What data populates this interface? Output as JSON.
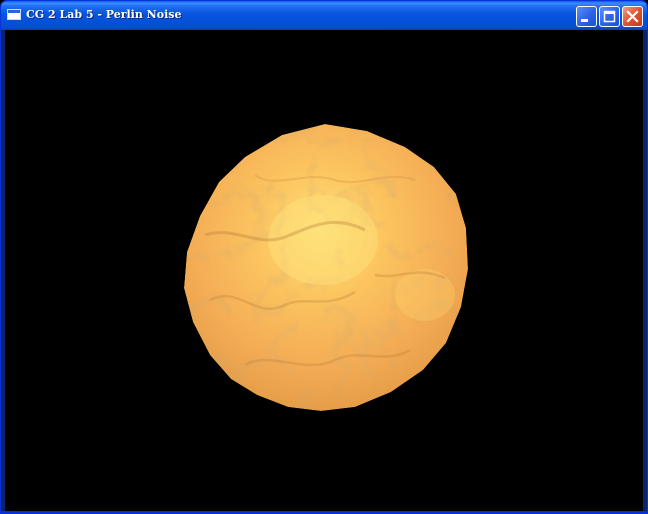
{
  "window": {
    "title": "CG 2 Lab 5 - Perlin Noise",
    "app_icon": "window-icon"
  },
  "titlebar_buttons": {
    "minimize": "minimize-icon",
    "maximize": "maximize-icon",
    "close": "close-icon"
  },
  "scene": {
    "background": "#000000",
    "sphere_colors": {
      "highlight": "#ffe27a",
      "mid": "#f7b35a",
      "shadow": "#d8843a",
      "vein": "#b57a3b"
    }
  }
}
